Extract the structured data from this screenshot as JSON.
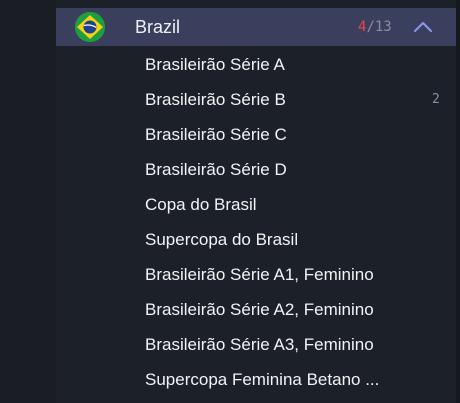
{
  "country": {
    "name": "Brazil",
    "count_active": "4",
    "count_separator": "/",
    "count_total": "13",
    "flag_icon": "brazil-flag-icon",
    "toggle_icon": "chevron-up-icon",
    "colors": {
      "header_bg": "#3a3f5e",
      "count_active": "#e5484d",
      "chevron": "#8f96f2"
    }
  },
  "leagues": [
    {
      "label": "Brasileirão Série A",
      "badge": ""
    },
    {
      "label": "Brasileirão Série B",
      "badge": "2"
    },
    {
      "label": "Brasileirão Série C",
      "badge": ""
    },
    {
      "label": "Brasileirão Série D",
      "badge": ""
    },
    {
      "label": "Copa do Brasil",
      "badge": ""
    },
    {
      "label": "Supercopa do Brasil",
      "badge": ""
    },
    {
      "label": "Brasileirão Série A1, Feminino",
      "badge": ""
    },
    {
      "label": "Brasileirão Série A2, Feminino",
      "badge": ""
    },
    {
      "label": "Brasileirão Série A3, Feminino",
      "badge": ""
    },
    {
      "label": "Supercopa Feminina Betano ...",
      "badge": ""
    }
  ]
}
